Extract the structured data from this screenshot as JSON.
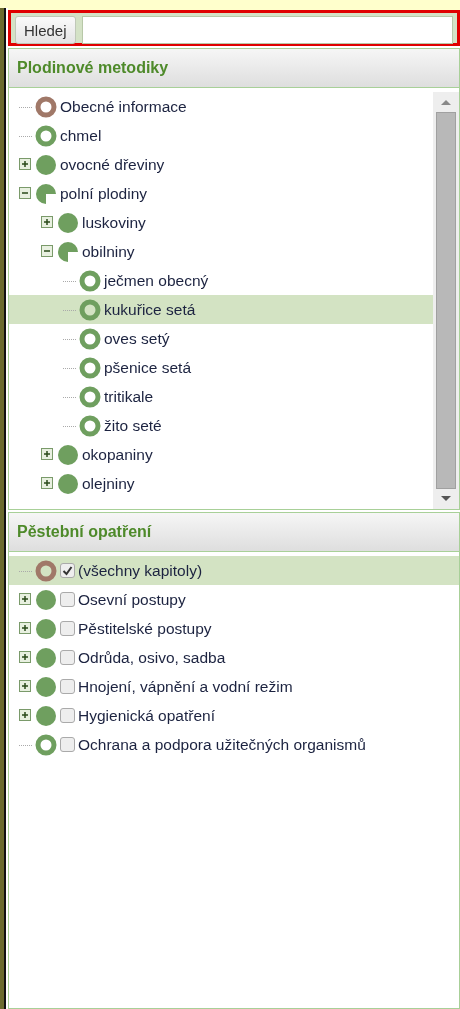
{
  "search": {
    "button": "Hledej"
  },
  "methods_panel": {
    "title": "Plodinové metodiky",
    "tree": [
      {
        "label": "Obecné informace",
        "color": "#a07868",
        "selected": false
      },
      {
        "label": "chmel",
        "color": "#6f9f5f",
        "selected": false
      },
      {
        "label": "ovocné dřeviny",
        "color": "#6f9f5f",
        "expanded": false,
        "selected": false
      },
      {
        "label": "polní plodiny",
        "color": "#6f9f5f",
        "expanded": true,
        "selected": false,
        "children": [
          {
            "label": "luskoviny",
            "color": "#6f9f5f",
            "expanded": false,
            "selected": false
          },
          {
            "label": "obilniny",
            "color": "#6f9f5f",
            "expanded": true,
            "selected": false,
            "children": [
              {
                "label": "ječmen obecný",
                "color": "#6f9f5f",
                "selected": false
              },
              {
                "label": "kukuřice setá",
                "color": "#6f9f5f",
                "selected": true
              },
              {
                "label": "oves setý",
                "color": "#6f9f5f",
                "selected": false
              },
              {
                "label": "pšenice setá",
                "color": "#6f9f5f",
                "selected": false
              },
              {
                "label": "tritikale",
                "color": "#6f9f5f",
                "selected": false
              },
              {
                "label": "žito seté",
                "color": "#6f9f5f",
                "selected": false
              }
            ]
          },
          {
            "label": "okopaniny",
            "color": "#6f9f5f",
            "expanded": false,
            "selected": false
          },
          {
            "label": "olejniny",
            "color": "#6f9f5f",
            "expanded": false,
            "selected": false
          }
        ]
      }
    ]
  },
  "measures_panel": {
    "title": "Pěstební opatření",
    "tree": [
      {
        "label": "(všechny kapitoly)",
        "color": "#a07868",
        "checked": true,
        "selected": true
      },
      {
        "label": "Osevní postupy",
        "color": "#6f9f5f",
        "expanded": false,
        "checked": false,
        "selected": false
      },
      {
        "label": "Pěstitelské postupy",
        "color": "#6f9f5f",
        "expanded": false,
        "checked": false,
        "selected": false
      },
      {
        "label": "Odrůda, osivo, sadba",
        "color": "#6f9f5f",
        "expanded": false,
        "checked": false,
        "selected": false
      },
      {
        "label": "Hnojení, vápnění a vodní režim",
        "color": "#6f9f5f",
        "expanded": false,
        "checked": false,
        "selected": false
      },
      {
        "label": "Hygienická opatření",
        "color": "#6f9f5f",
        "expanded": false,
        "checked": false,
        "selected": false
      },
      {
        "label": "Ochrana a podpora užitečných organismů",
        "color": "#6f9f5f",
        "checked": false,
        "selected": false
      }
    ]
  }
}
